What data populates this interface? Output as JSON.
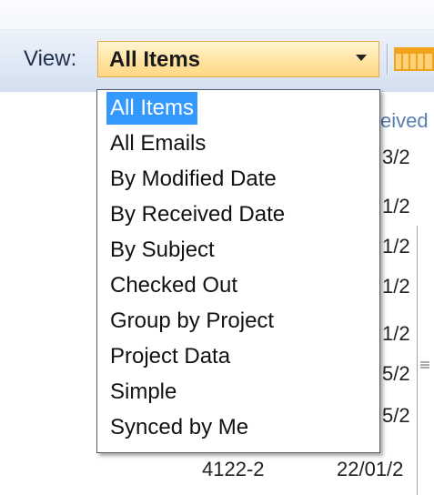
{
  "toolbar": {
    "view_label": "View:",
    "view_selected": "All Items"
  },
  "background": {
    "received_header_fragment": "eived",
    "date_fragments": [
      "3/2",
      "1/2",
      "1/2",
      "1/2",
      "1/2",
      "5/2",
      "5/2"
    ],
    "bottom_row_id": "4122-2",
    "bottom_row_date": "22/01/2"
  },
  "dropdown": {
    "items": [
      {
        "label": "All Items",
        "selected": true
      },
      {
        "label": "All Emails",
        "selected": false
      },
      {
        "label": "By Modified Date",
        "selected": false
      },
      {
        "label": "By Received Date",
        "selected": false
      },
      {
        "label": "By Subject",
        "selected": false
      },
      {
        "label": "Checked Out",
        "selected": false
      },
      {
        "label": "Group by Project",
        "selected": false
      },
      {
        "label": "Project Data",
        "selected": false
      },
      {
        "label": "Simple",
        "selected": false
      },
      {
        "label": "Synced by Me",
        "selected": false
      }
    ]
  },
  "colors": {
    "selection": "#3399ff",
    "combo_border": "#e2a94e",
    "toolbar_bg": "#dfe8f5",
    "grid_icon": "#f3a21b"
  },
  "icons": {
    "grid": "grid-view-icon",
    "dropdown": "chevron-down-icon"
  }
}
